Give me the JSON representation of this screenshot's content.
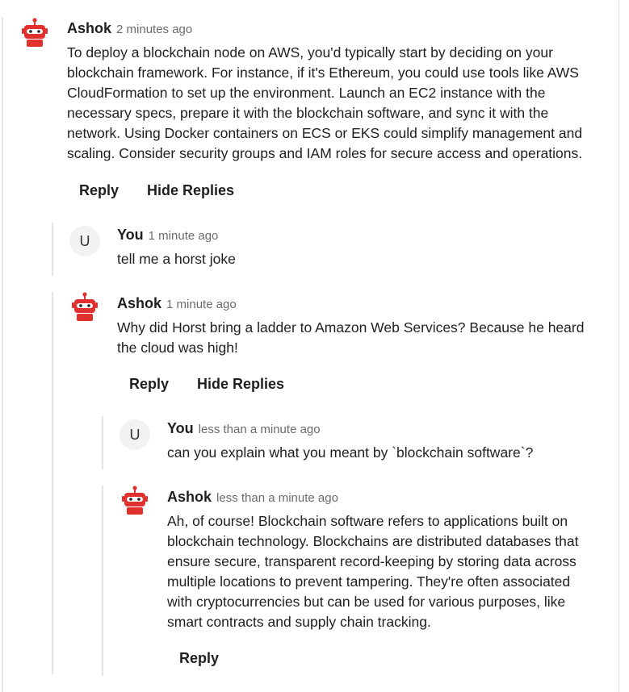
{
  "comments": [
    {
      "author": "Ashok",
      "time": "2 minutes ago",
      "avatar": "robot-icon",
      "text": "To deploy a blockchain node on AWS, you'd typically start by deciding on your blockchain framework. For instance, if it's Ethereum, you could use tools like AWS CloudFormation to set up the environment. Launch an EC2 instance with the necessary specs, prepare it with the blockchain software, and sync it with the network. Using Docker containers on ECS or EKS could simplify management and scaling. Consider security groups and IAM roles for secure access and operations.",
      "reply_label": "Reply",
      "hide_label": "Hide Replies"
    },
    {
      "author": "You",
      "time": "1 minute ago",
      "avatar_initial": "U",
      "text": "tell me a horst joke"
    },
    {
      "author": "Ashok",
      "time": "1 minute ago",
      "avatar": "robot-icon",
      "text": "Why did Horst bring a ladder to Amazon Web Services? Because he heard the cloud was high!",
      "reply_label": "Reply",
      "hide_label": "Hide Replies"
    },
    {
      "author": "You",
      "time": "less than a minute ago",
      "avatar_initial": "U",
      "text": "can you explain what you meant by `blockchain software`?"
    },
    {
      "author": "Ashok",
      "time": "less than a minute ago",
      "avatar": "robot-icon",
      "text": "Ah, of course! Blockchain software refers to applications built on blockchain technology. Blockchains are distributed databases that ensure secure, transparent record-keeping by storing data across multiple locations to prevent tampering. They're often associated with cryptocurrencies but can be used for various purposes, like smart contracts and supply chain tracking.",
      "reply_label": "Reply"
    }
  ],
  "colors": {
    "robot_red": "#e0312f",
    "thread_line": "#e3e3e3"
  }
}
